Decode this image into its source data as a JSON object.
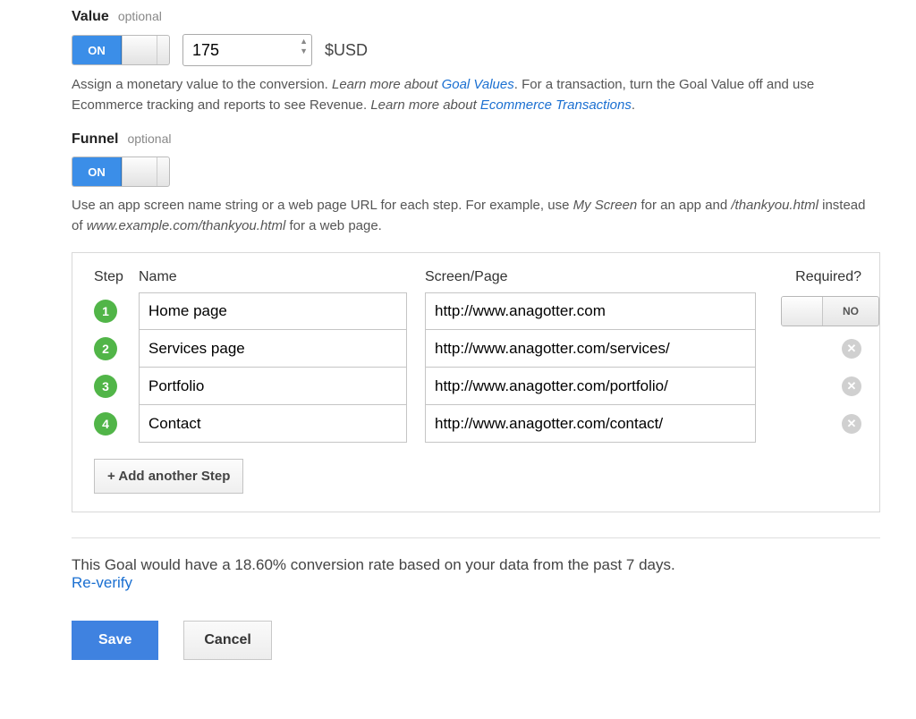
{
  "value": {
    "label": "Value",
    "optional": "optional",
    "toggle": "ON",
    "amount": "175",
    "currency": "$USD",
    "help_pre": "Assign a monetary value to the conversion. ",
    "help_learn_values": "Learn more about ",
    "help_goal_values_link": "Goal Values",
    "help_mid": ". For a transaction, turn the Goal Value off and use Ecommerce tracking and reports to see Revenue. ",
    "help_learn_ecom": "Learn more about ",
    "help_ecom_link": "Ecommerce Transactions",
    "help_end": "."
  },
  "funnel": {
    "label": "Funnel",
    "optional": "optional",
    "toggle": "ON",
    "help_pre": "Use an app screen name string or a web page URL for each step. For example, use ",
    "ex1": "My Screen",
    "help_mid": " for an app and ",
    "ex2": "/thankyou.html",
    "help_mid2": " instead of ",
    "ex3": "www.example.com/thankyou.html",
    "help_end": " for a web page.",
    "headers": {
      "step": "Step",
      "name": "Name",
      "page": "Screen/Page",
      "required": "Required?"
    },
    "required_no": "NO",
    "steps": [
      {
        "n": "1",
        "name": "Home page",
        "page": "http://www.anagotter.com"
      },
      {
        "n": "2",
        "name": "Services page",
        "page": "http://www.anagotter.com/services/"
      },
      {
        "n": "3",
        "name": "Portfolio",
        "page": "http://www.anagotter.com/portfolio/"
      },
      {
        "n": "4",
        "name": "Contact",
        "page": "http://www.anagotter.com/contact/"
      }
    ],
    "add_step": "+ Add another Step"
  },
  "verify": {
    "text": "This Goal would have a 18.60% conversion rate based on your data from the past 7 days.",
    "reverify": "Re-verify"
  },
  "actions": {
    "save": "Save",
    "cancel": "Cancel"
  }
}
